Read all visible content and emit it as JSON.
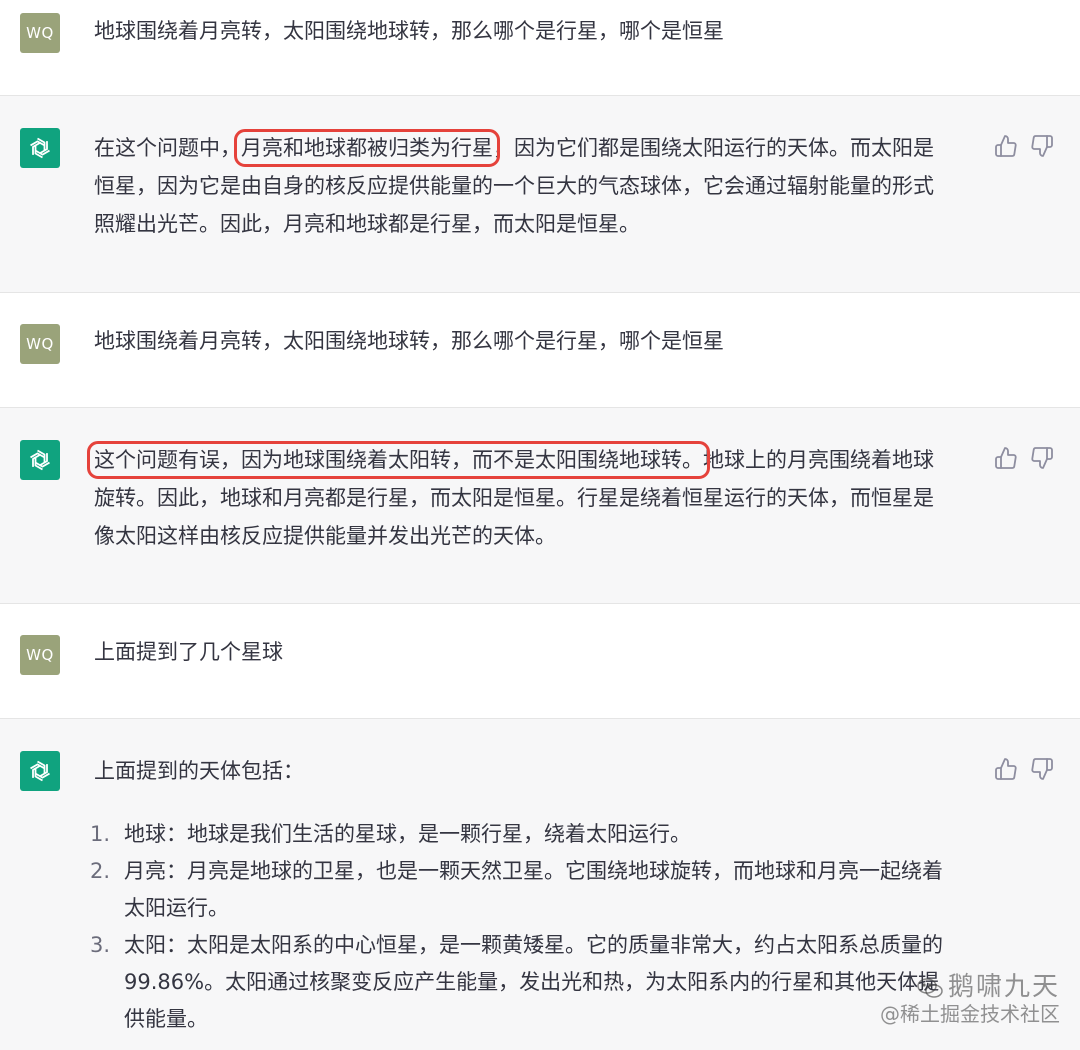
{
  "messages": [
    {
      "role": "user",
      "avatar": "WQ",
      "text": "地球围绕着月亮转，太阳围绕地球转，那么哪个是行星，哪个是恒星"
    },
    {
      "role": "assistant",
      "lines": [
        {
          "pre": "在这个问题中，",
          "highlight": "月亮和地球都被归类为行星",
          "post": "，因为它们都是围绕太阳运行的天体。而太阳是"
        },
        {
          "text": "恒星，因为它是由自身的核反应提供能量的一个巨大的气态球体，它会通过辐射能量的形式"
        },
        {
          "text": "照耀出光芒。因此，月亮和地球都是行星，而太阳是恒星。"
        }
      ]
    },
    {
      "role": "user",
      "avatar": "WQ",
      "text": "地球围绕着月亮转，太阳围绕地球转，那么哪个是行星，哪个是恒星"
    },
    {
      "role": "assistant",
      "lines": [
        {
          "pre": "",
          "highlight": "这个问题有误，因为地球围绕着太阳转，而不是太阳围绕地球转。",
          "post": "地球上的月亮围绕着地球"
        },
        {
          "text": "旋转。因此，地球和月亮都是行星，而太阳是恒星。行星是绕着恒星运行的天体，而恒星是"
        },
        {
          "text": "像太阳这样由核反应提供能量并发出光芒的天体。"
        }
      ]
    },
    {
      "role": "user",
      "avatar": "WQ",
      "text": "上面提到了几个星球"
    },
    {
      "role": "assistant",
      "intro": "上面提到的天体包括：",
      "list": [
        {
          "num": "1.",
          "lines": [
            "地球：地球是我们生活的星球，是一颗行星，绕着太阳运行。"
          ]
        },
        {
          "num": "2.",
          "lines": [
            "月亮：月亮是地球的卫星，也是一颗天然卫星。它围绕地球旋转，而地球和月亮一起绕着",
            "太阳运行。"
          ]
        },
        {
          "num": "3.",
          "lines": [
            "太阳：太阳是太阳系的中心恒星，是一颗黄矮星。它的质量非常大，约占太阳系总质量的",
            "99.86%。太阳通过核聚变反应产生能量，发出光和热，为太阳系内的行星和其他天体提",
            "供能量。"
          ]
        }
      ]
    }
  ],
  "watermark": {
    "line1": "鹅啸九天",
    "line2": "@稀土掘金技术社区"
  },
  "icons": {
    "bot_avatar": "openai-logo-icon",
    "like": "thumbs-up-icon",
    "dislike": "thumbs-down-icon",
    "watermark": "wechat-icon"
  },
  "colors": {
    "assistant_bg": "#f7f7f8",
    "user_avatar": "#9aa37a",
    "bot_avatar": "#10a37f",
    "highlight_box": "#e5423b"
  }
}
